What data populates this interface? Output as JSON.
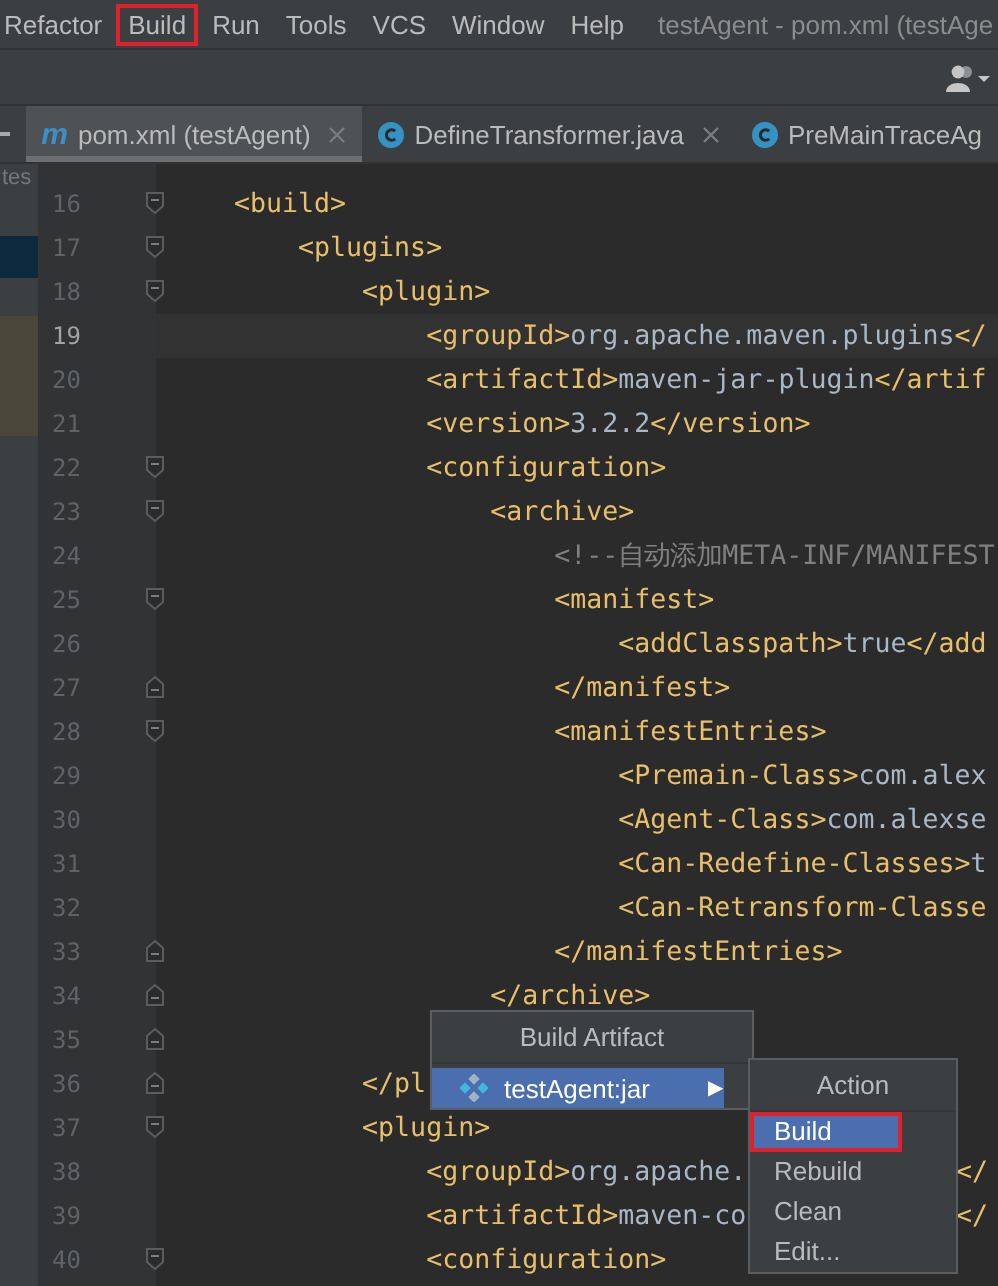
{
  "menu_bar": {
    "items": [
      {
        "label": "Refactor",
        "annotated": false
      },
      {
        "label": "Build",
        "annotated": true
      },
      {
        "label": "Run",
        "annotated": false
      },
      {
        "label": "Tools",
        "annotated": false
      },
      {
        "label": "VCS",
        "annotated": false
      },
      {
        "label": "Window",
        "annotated": false
      },
      {
        "label": "Help",
        "annotated": false
      }
    ],
    "title": "testAgent - pom.xml (testAge"
  },
  "tabs": [
    {
      "label": "pom.xml (testAgent)",
      "icon": "m",
      "kind": "maven",
      "selected": true,
      "closable": true
    },
    {
      "label": "DefineTransformer.java",
      "kind": "class",
      "selected": false,
      "closable": true
    },
    {
      "label": "PreMainTraceAg",
      "kind": "class",
      "selected": false,
      "closable": false
    }
  ],
  "project_panel": {
    "label": "tes"
  },
  "editor": {
    "lines": [
      {
        "number": "16",
        "kind": "fold_start",
        "current": false,
        "parts": [
          {
            "kind": "tag",
            "text": "<build>"
          }
        ]
      },
      {
        "number": "17",
        "kind": "fold_start",
        "current": false,
        "parts": [
          {
            "kind": "tag",
            "text": "    <plugins>"
          }
        ]
      },
      {
        "number": "18",
        "kind": "fold_start",
        "current": false,
        "parts": [
          {
            "kind": "tag",
            "text": "        <plugin>"
          }
        ]
      },
      {
        "number": "19",
        "kind": "plain",
        "current": true,
        "parts": [
          {
            "kind": "tag",
            "text": "            <groupId>"
          },
          {
            "kind": "text",
            "text": "org.apache.maven.plugins"
          },
          {
            "kind": "tag",
            "text": "</"
          }
        ]
      },
      {
        "number": "20",
        "kind": "plain",
        "current": false,
        "parts": [
          {
            "kind": "tag",
            "text": "            <artifactId>"
          },
          {
            "kind": "text",
            "text": "maven-jar-plugin"
          },
          {
            "kind": "tag",
            "text": "</artif"
          }
        ]
      },
      {
        "number": "21",
        "kind": "plain",
        "current": false,
        "parts": [
          {
            "kind": "tag",
            "text": "            <version>"
          },
          {
            "kind": "text",
            "text": "3.2.2"
          },
          {
            "kind": "tag",
            "text": "</version>"
          }
        ]
      },
      {
        "number": "22",
        "kind": "fold_start",
        "current": false,
        "parts": [
          {
            "kind": "tag",
            "text": "            <configuration>"
          }
        ]
      },
      {
        "number": "23",
        "kind": "fold_start",
        "current": false,
        "parts": [
          {
            "kind": "tag",
            "text": "                <archive>"
          }
        ]
      },
      {
        "number": "24",
        "kind": "plain",
        "current": false,
        "parts": [
          {
            "kind": "comment",
            "text": "                    <!--自动添加META-INF/MANIFEST"
          }
        ]
      },
      {
        "number": "25",
        "kind": "fold_start",
        "current": false,
        "parts": [
          {
            "kind": "tag",
            "text": "                    <manifest>"
          }
        ]
      },
      {
        "number": "26",
        "kind": "plain",
        "current": false,
        "parts": [
          {
            "kind": "tag",
            "text": "                        <addClasspath>"
          },
          {
            "kind": "text",
            "text": "true"
          },
          {
            "kind": "tag",
            "text": "</add"
          }
        ]
      },
      {
        "number": "27",
        "kind": "fold_end",
        "current": false,
        "parts": [
          {
            "kind": "tag",
            "text": "                    </manifest>"
          }
        ]
      },
      {
        "number": "28",
        "kind": "fold_start",
        "current": false,
        "parts": [
          {
            "kind": "tag",
            "text": "                    <manifestEntries>"
          }
        ]
      },
      {
        "number": "29",
        "kind": "plain",
        "current": false,
        "parts": [
          {
            "kind": "tag",
            "text": "                        <Premain-Class>"
          },
          {
            "kind": "text",
            "text": "com.alex"
          }
        ]
      },
      {
        "number": "30",
        "kind": "plain",
        "current": false,
        "parts": [
          {
            "kind": "tag",
            "text": "                        <Agent-Class>"
          },
          {
            "kind": "text",
            "text": "com.alexse"
          }
        ]
      },
      {
        "number": "31",
        "kind": "plain",
        "current": false,
        "parts": [
          {
            "kind": "tag",
            "text": "                        <Can-Redefine-Classes>"
          },
          {
            "kind": "text",
            "text": "t"
          }
        ]
      },
      {
        "number": "32",
        "kind": "plain",
        "current": false,
        "parts": [
          {
            "kind": "tag",
            "text": "                        <Can-Retransform-Classe"
          }
        ]
      },
      {
        "number": "33",
        "kind": "fold_end",
        "current": false,
        "parts": [
          {
            "kind": "tag",
            "text": "                    </manifestEntries>"
          }
        ]
      },
      {
        "number": "34",
        "kind": "fold_end",
        "current": false,
        "parts": [
          {
            "kind": "tag",
            "text": "                </archive>"
          }
        ]
      },
      {
        "number": "35",
        "kind": "fold_end",
        "current": false
      },
      {
        "number": "36",
        "kind": "fold_end",
        "current": false,
        "parts": [
          {
            "kind": "tag",
            "text": "        </pl"
          }
        ]
      },
      {
        "number": "37",
        "kind": "fold_start",
        "current": false,
        "parts": [
          {
            "kind": "tag",
            "text": "        <plugin>"
          }
        ]
      },
      {
        "number": "38",
        "kind": "plain",
        "current": false,
        "parts": [
          {
            "kind": "tag",
            "text": "            <groupId>"
          },
          {
            "kind": "text",
            "text": "org.apache."
          }
        ],
        "tail": "</"
      },
      {
        "number": "39",
        "kind": "plain",
        "current": false,
        "parts": [
          {
            "kind": "tag",
            "text": "            <artifactId>"
          },
          {
            "kind": "text",
            "text": "maven-co"
          }
        ],
        "tail": "</"
      },
      {
        "number": "40",
        "kind": "fold_start",
        "current": false,
        "parts": [
          {
            "kind": "tag",
            "text": "            <configuration>"
          }
        ]
      }
    ]
  },
  "build_artifact_popup": {
    "title": "Build Artifact",
    "items": [
      {
        "label": "testAgent:jar",
        "selected": true,
        "submenu_arrow": "▶"
      }
    ]
  },
  "action_menu": {
    "title": "Action",
    "items": [
      {
        "label": "Build",
        "selected": true,
        "annotated": true
      },
      {
        "label": "Rebuild",
        "selected": false,
        "annotated": false
      },
      {
        "label": "Clean",
        "selected": false,
        "annotated": false
      },
      {
        "label": "Edit...",
        "selected": false,
        "annotated": false
      }
    ]
  }
}
